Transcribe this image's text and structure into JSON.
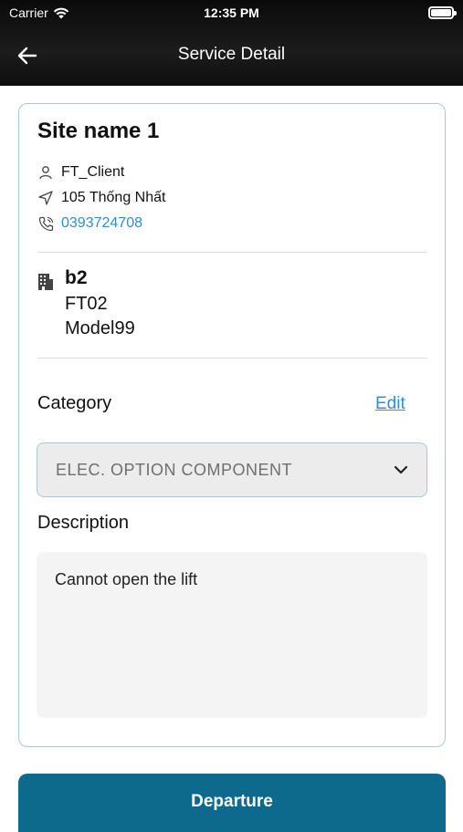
{
  "status_bar": {
    "carrier": "Carrier",
    "time": "12:35 PM"
  },
  "nav": {
    "title": "Service Detail"
  },
  "site": {
    "name": "Site name 1",
    "client": "FT_Client",
    "address": "105 Thống Nhất",
    "phone": "0393724708"
  },
  "building": {
    "name": "b2",
    "line1": "FT02",
    "line2": "Model99"
  },
  "category": {
    "label": "Category",
    "edit_label": "Edit",
    "selected": "ELEC. OPTION COMPONENT"
  },
  "description": {
    "label": "Description",
    "text": "Cannot open the lift"
  },
  "actions": {
    "departure_label": "Departure"
  },
  "colors": {
    "accent_link": "#2d8fd5",
    "primary_button": "#0e6a8c",
    "card_border": "#a9c8dd"
  }
}
